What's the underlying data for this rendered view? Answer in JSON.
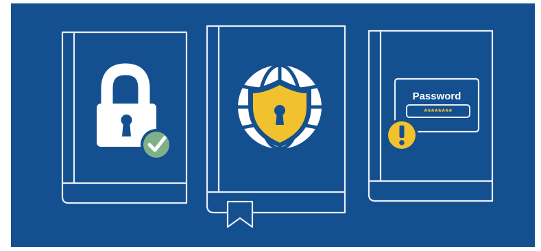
{
  "illustration": {
    "password_field": {
      "label": "Password",
      "masked_value": "********"
    }
  },
  "icons": [
    "book-left-icon",
    "padlock-icon",
    "check-badge-icon",
    "book-center-icon",
    "globe-icon",
    "shield-icon",
    "keyhole-icon",
    "bookmark-icon",
    "book-right-icon",
    "password-field-icon",
    "warning-icon"
  ],
  "colors": {
    "background": "#14508f",
    "outline": "#e8eef6",
    "lock": "#ffffff",
    "check": "#7fb08a",
    "shield": "#f2c12e",
    "globe": "#ffffff",
    "warning": "#f2c12e",
    "password_mask": "#f2c12e"
  }
}
